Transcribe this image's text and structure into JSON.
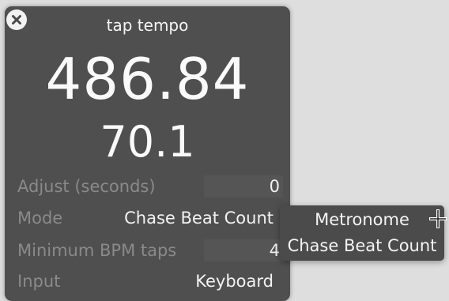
{
  "window": {
    "title": "tap tempo"
  },
  "readout": {
    "seconds": "486.84",
    "bpm": "70.1"
  },
  "settings": {
    "adjust": {
      "label": "Adjust (seconds)",
      "value": "0"
    },
    "mode": {
      "label": "Mode",
      "value": "Chase Beat Count"
    },
    "min_taps": {
      "label": "Minimum BPM taps",
      "value": "4"
    },
    "input": {
      "label": "Input",
      "value": "Keyboard"
    }
  },
  "mode_menu": {
    "options": [
      "Metronome",
      "Chase Beat Count"
    ]
  },
  "colors": {
    "panel": "#4f4f4f",
    "background": "#dedede",
    "label_dim": "#8a8a8a",
    "text": "#f2f2f2"
  }
}
